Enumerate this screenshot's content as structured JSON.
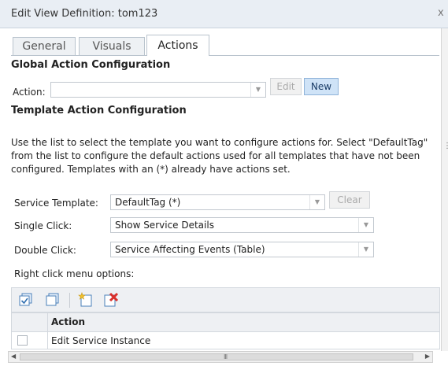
{
  "window": {
    "title": "Edit View Definition: tom123",
    "close_glyph": "x"
  },
  "tabs": [
    {
      "label": "General",
      "active": false
    },
    {
      "label": "Visuals",
      "active": false
    },
    {
      "label": "Actions",
      "active": true
    }
  ],
  "global_action": {
    "heading": "Global Action Configuration",
    "action_label": "Action:",
    "action_value": "",
    "edit_label": "Edit",
    "new_label": "New"
  },
  "template_action": {
    "heading": "Template Action Configuration",
    "description": "Use the list to select the template you want to configure actions for. Select \"DefaultTag\" from the list to configure the default actions used for all templates that have not been configured. Templates with an (*) already have actions set.",
    "service_template_label": "Service Template:",
    "service_template_value": "DefaultTag (*)",
    "clear_label": "Clear",
    "single_click_label": "Single Click:",
    "single_click_value": "Show Service Details",
    "double_click_label": "Double Click:",
    "double_click_value": "Service Affecting Events (Table)",
    "right_click_label": "Right click menu options:"
  },
  "toolbar": {
    "icons": [
      "select-all-icon",
      "deselect-all-icon",
      "new-item-icon",
      "delete-item-icon"
    ]
  },
  "grid": {
    "columns": [
      "",
      "Action"
    ],
    "rows": [
      {
        "checked": false,
        "action": "Edit Service Instance"
      }
    ]
  },
  "scrollbar": {
    "grip": "III"
  },
  "colors": {
    "accent": "#cfe3f7",
    "titlebar": "#e9eef4",
    "delete_red": "#d9302c",
    "new_yellow": "#f2c230"
  }
}
